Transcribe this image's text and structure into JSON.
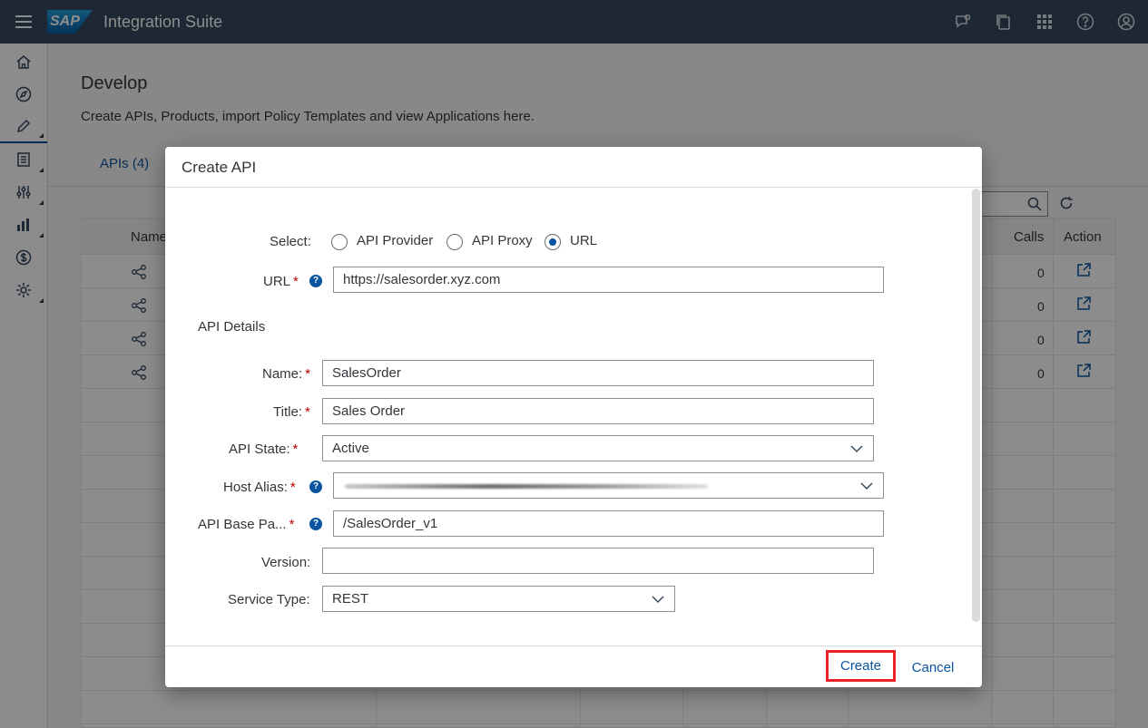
{
  "shell": {
    "app_title": "Integration Suite",
    "logo_text": "SAP",
    "icons": [
      "feedback-icon",
      "notifications-icon",
      "product-switch-icon",
      "help-icon",
      "user-avatar-icon"
    ]
  },
  "sidenav": {
    "items": [
      "home",
      "discover",
      "develop",
      "test",
      "configure",
      "analyze",
      "monetize",
      "settings"
    ]
  },
  "page": {
    "title": "Develop",
    "subtitle": "Create APIs, Products, import Policy Templates and view Applications here.",
    "tab_apis": "APIs (4)",
    "table": {
      "headers": {
        "name": "Name",
        "calls": "Calls",
        "action": "Action"
      },
      "rows": [
        {
          "calls": "0"
        },
        {
          "calls": "0"
        },
        {
          "calls": "0"
        },
        {
          "calls": "0"
        }
      ]
    }
  },
  "dialog": {
    "title": "Create API",
    "select_label": "Select:",
    "options": [
      "API Provider",
      "API Proxy",
      "URL"
    ],
    "selected_option": "URL",
    "url_label": "URL",
    "url_value": "https://salesorder.xyz.com",
    "section_title": "API Details",
    "name_label": "Name:",
    "name_value": "SalesOrder",
    "title_label": "Title:",
    "title_value": "Sales Order",
    "state_label": "API State:",
    "state_value": "Active",
    "host_label": "Host Alias:",
    "base_path_label": "API Base Pa...",
    "base_path_value": "/SalesOrder_v1",
    "version_label": "Version:",
    "version_value": "",
    "service_type_label": "Service Type:",
    "service_type_value": "REST",
    "help_glyph": "?",
    "required_mark": "*",
    "create_label": "Create",
    "cancel_label": "Cancel"
  }
}
